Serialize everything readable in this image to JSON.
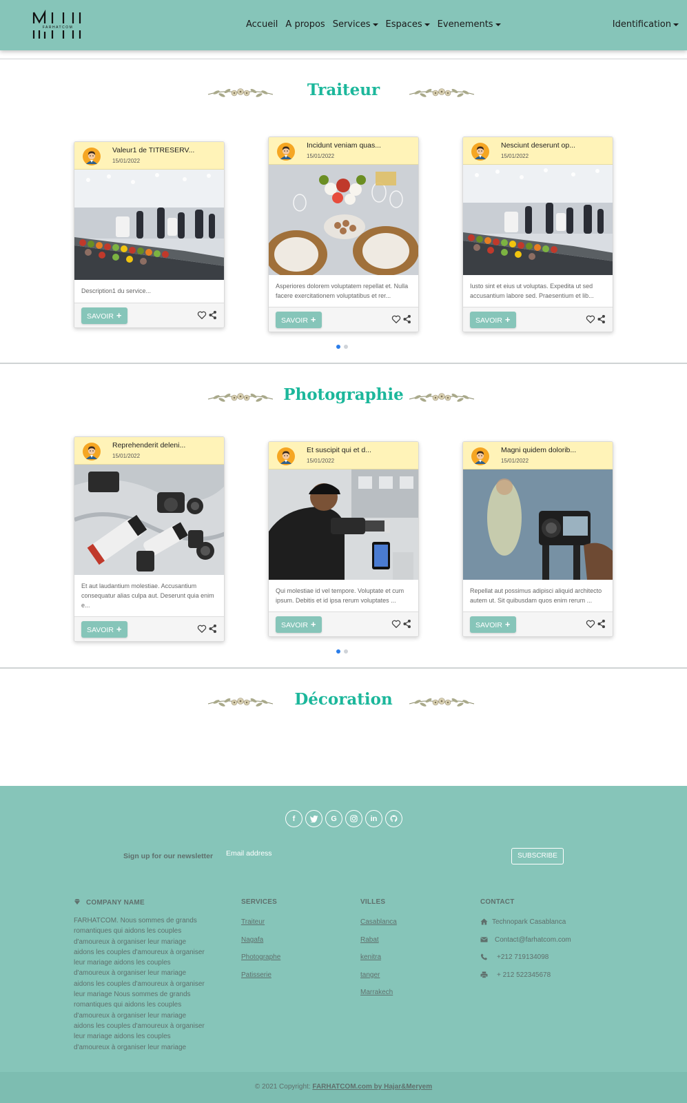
{
  "brand": {
    "logo_text": "FARHATCOM"
  },
  "nav": {
    "items": [
      {
        "label": "Accueil",
        "dropdown": false
      },
      {
        "label": "A propos",
        "dropdown": false
      },
      {
        "label": "Services",
        "dropdown": true
      },
      {
        "label": "Espaces",
        "dropdown": true
      },
      {
        "label": "Evenements",
        "dropdown": true
      }
    ],
    "identification": "Identification"
  },
  "sections": [
    {
      "title": "Traiteur",
      "cards": [
        {
          "title": "Valeur1 de TITRESERV...",
          "date": "15/01/2022",
          "image": "buffet-hall",
          "description": "Description1 du service..."
        },
        {
          "title": "Incidunt veniam quas...",
          "date": "15/01/2022",
          "image": "table-setting",
          "description": "Asperiores dolorem voluptatem repellat et. Nulla facere exercitationem voluptatibus et rer..."
        },
        {
          "title": "Nesciunt deserunt op...",
          "date": "15/01/2022",
          "image": "buffet-hall",
          "description": "Iusto sint et eius ut voluptas. Expedita ut sed accusantium labore sed. Praesentium et lib..."
        }
      ]
    },
    {
      "title": "Photographie",
      "cards": [
        {
          "title": "Reprehenderit deleni...",
          "date": "15/01/2022",
          "image": "camera-lenses",
          "description": "Et aut laudantium molestiae. Accusantium consequatur alias culpa aut. Deserunt quia enim e..."
        },
        {
          "title": "Et suscipit qui et d...",
          "date": "15/01/2022",
          "image": "photographer",
          "description": "Qui molestiae id vel tempore. Voluptate et cum ipsum. Debitis et id ipsa rerum voluptates ..."
        },
        {
          "title": "Magni quidem dolorib...",
          "date": "15/01/2022",
          "image": "video-camera",
          "description": "Repellat aut possimus adipisci aliquid architecto autem ut. Sit quibusdam quos enim rerum ..."
        }
      ]
    },
    {
      "title": "Décoration",
      "cards": []
    }
  ],
  "card_button_label": "SAVOIR",
  "footer": {
    "socials": [
      "facebook-icon",
      "twitter-icon",
      "google-icon",
      "instagram-icon",
      "linkedin-icon",
      "github-icon"
    ],
    "newsletter_label": "Sign up for our newsletter",
    "email_placeholder": "Email address",
    "subscribe_label": "SUBSCRIBE",
    "company": {
      "heading": "COMPANY NAME",
      "text": "FARHATCOM. Nous sommes de grands romantiques qui aidons les couples d'amoureux à organiser leur mariage aidons les couples d'amoureux à organiser leur mariage aidons les couples d'amoureux à organiser leur mariage aidons les couples d'amoureux à organiser leur mariage Nous sommes de grands romantiques qui aidons les couples d'amoureux à organiser leur mariage aidons les couples d'amoureux à organiser leur mariage aidons les couples d'amoureux à organiser leur mariage"
    },
    "services": {
      "heading": "SERVICES",
      "links": [
        "Traiteur",
        "Nagafa",
        "Photographe",
        "Patisserie"
      ]
    },
    "villes": {
      "heading": "VILLES",
      "links": [
        "Casablanca",
        "Rabat",
        "kenitra",
        "tanger",
        "Marrakech"
      ]
    },
    "contact": {
      "heading": "CONTACT",
      "items": [
        {
          "icon": "home-icon",
          "text": "Technopark Casablanca"
        },
        {
          "icon": "envelope-icon",
          "text": "Contact@farhatcom.com"
        },
        {
          "icon": "phone-icon",
          "text": "+212 719134098"
        },
        {
          "icon": "print-icon",
          "text": "+ 212 522345678"
        }
      ]
    },
    "copyright_prefix": "© 2021 Copyright:",
    "copyright_link": "FARHATCOM.com by Hajar&Meryem"
  },
  "colors": {
    "navbar": "#86c5b9",
    "accent_title": "#1cb79b",
    "card_header": "#fff3b8",
    "dot_active": "#2b7de9"
  }
}
